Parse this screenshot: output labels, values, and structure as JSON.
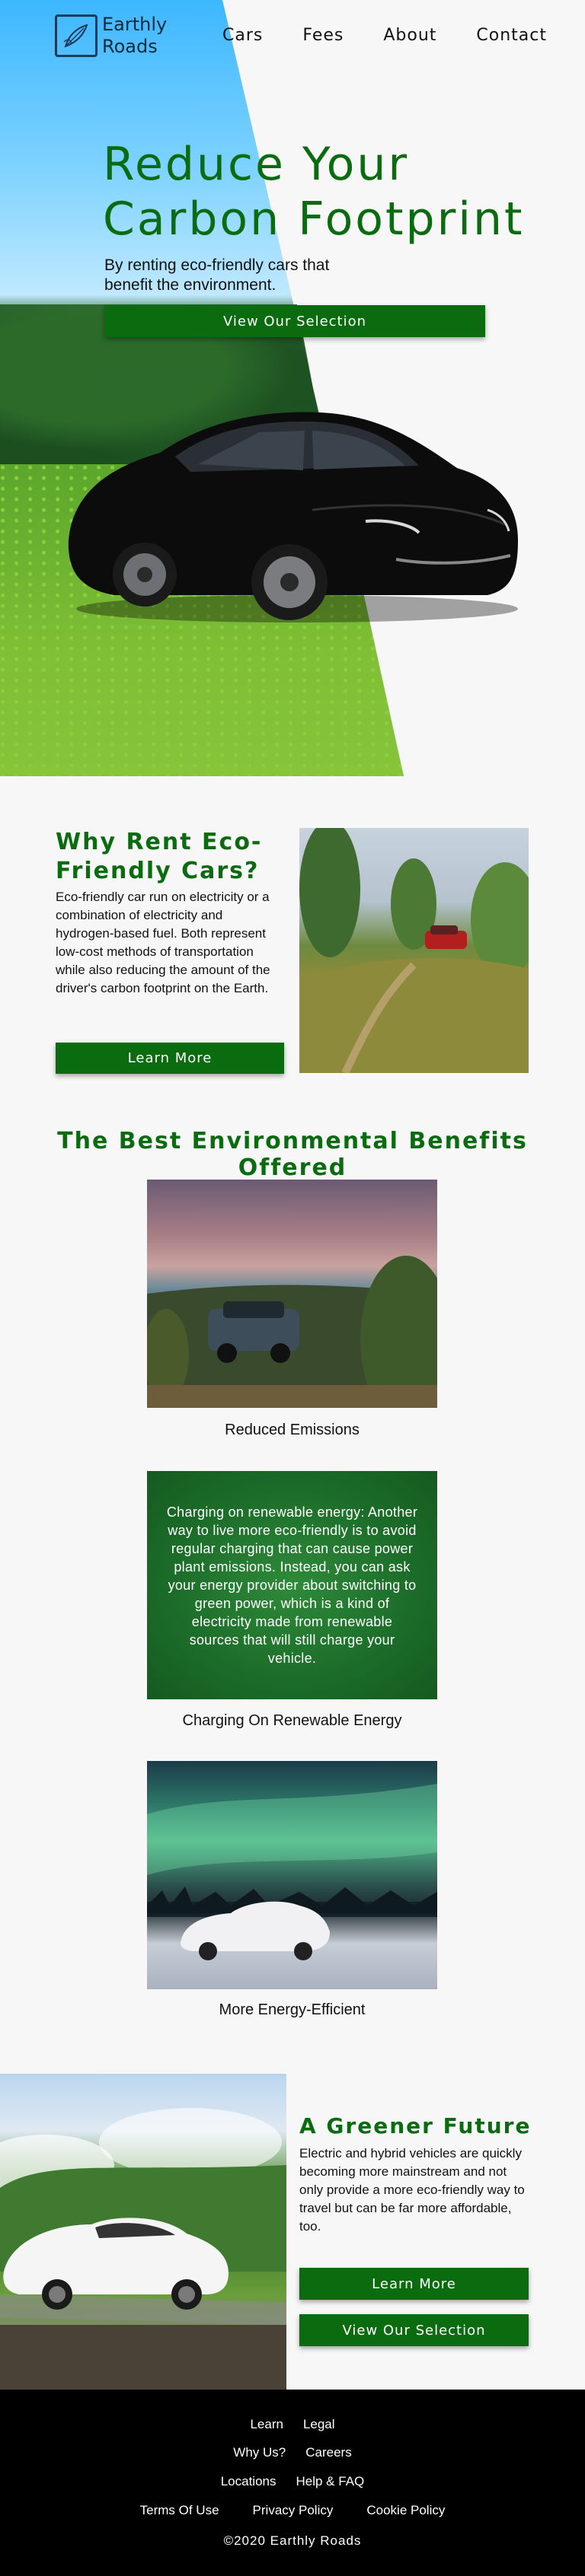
{
  "brand": {
    "name_line1": "Earthly",
    "name_line2": "Roads"
  },
  "nav": {
    "links": [
      "Cars",
      "Fees",
      "About",
      "Contact"
    ]
  },
  "hero": {
    "title": "Reduce Your Carbon Footprint",
    "subtitle": "By renting eco-friendly cars that benefit the environment.",
    "button": "View Our Selection"
  },
  "why": {
    "title": "Why Rent Eco-Friendly Cars?",
    "text": "Eco-friendly car run on electricity or a combination of electricity and hydrogen-based fuel. Both represent low-cost methods of transportation while also reducing the amount of the driver's carbon footprint on the Earth.",
    "button": "Learn More"
  },
  "benefits": {
    "title": "The Best Environmental Benefits Offered",
    "cards": [
      {
        "label": "Reduced Emissions"
      },
      {
        "label": "Charging On Renewable Energy",
        "overlay_text": "Charging on renewable energy: Another way to live more eco-friendly is to avoid regular charging that can cause power plant emissions. Instead, you can ask your energy provider about switching to green power, which is a kind of electricity made from renewable sources that will still charge your vehicle."
      },
      {
        "label": "More Energy-Efficient"
      }
    ]
  },
  "greener": {
    "title": "A Greener Future",
    "text": "Electric and hybrid vehicles are quickly becoming more mainstream and not only provide a more eco-friendly way to travel but can be far more affordable, too.",
    "button_primary": "Learn More",
    "button_secondary": "View Our Selection"
  },
  "footer": {
    "row1": [
      "Learn",
      "Legal"
    ],
    "row2": [
      "Why Us?",
      "Careers"
    ],
    "row3": [
      "Locations",
      "Help & FAQ"
    ],
    "row4": [
      "Terms Of Use",
      "Privacy Policy",
      "Cookie Policy"
    ],
    "copyright": "©2020 Earthly Roads"
  },
  "colors": {
    "accent_green": "#0a6b0f",
    "footer_bg": "#000000",
    "page_bg": "#f7f7f7"
  }
}
